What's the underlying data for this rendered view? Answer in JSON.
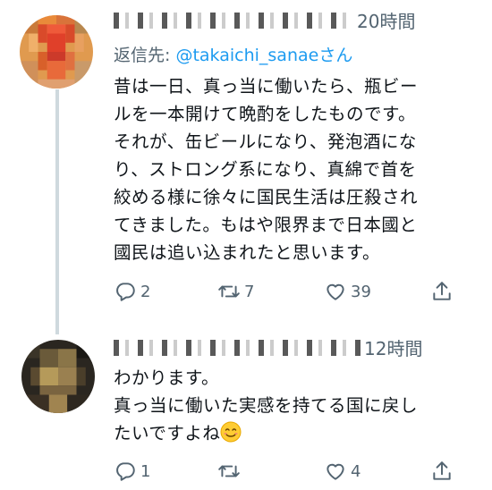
{
  "tweets": [
    {
      "time": "20時間",
      "reply_prefix": "返信先: ",
      "reply_handle": "@takaichi_sanae",
      "reply_suffix": "さん",
      "text": "昔は一日、真っ当に働いたら、瓶ビー\nルを一本開けて晩酌をしたものです。\nそれが、缶ビールになり、発泡酒にな\nり、ストロング系になり、真綿で首を\n絞める様に徐々に国民生活は圧殺され\nてきました。もはや限界まで日本國と\n國民は追い込まれたと思います。",
      "replies": "2",
      "retweets": "7",
      "likes": "39"
    },
    {
      "time": "12時間",
      "text": "わかります。\n真っ当に働いた実感を持てる国に戻し\nたいですよね",
      "replies": "1",
      "retweets": "",
      "likes": "4"
    }
  ],
  "icons": [
    "reply-icon",
    "retweet-icon",
    "like-icon",
    "share-icon",
    "smiling-face-emoji"
  ],
  "colors": {
    "text": "#0f1419",
    "muted": "#536471",
    "link": "#1d9bf0",
    "thread": "#cfd9de"
  }
}
